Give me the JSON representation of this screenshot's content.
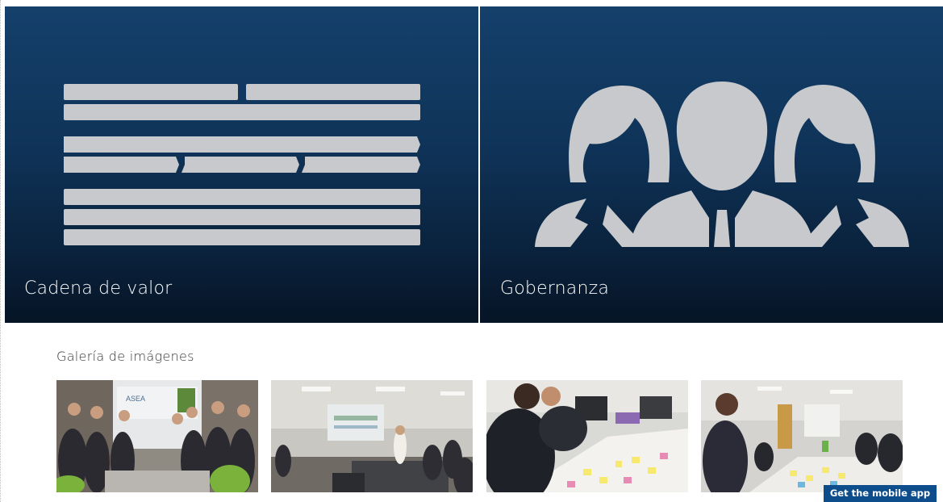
{
  "tiles": {
    "left": {
      "title": "Cadena de valor",
      "icon": "value-chain-bars-icon"
    },
    "right": {
      "title": "Gobernanza",
      "icon": "people-group-icon"
    }
  },
  "gallery": {
    "title": "Galería de imágenes",
    "photos": [
      {
        "slide_logo_text": "ASEA"
      },
      {},
      {},
      {}
    ]
  },
  "mobile_app_button": "Get the mobile app",
  "colors": {
    "tile_gradient_top": "#14406b",
    "tile_gradient_bottom": "#061426",
    "icon_gray": "#c7c9cc",
    "button_blue": "#0d4d8c"
  }
}
